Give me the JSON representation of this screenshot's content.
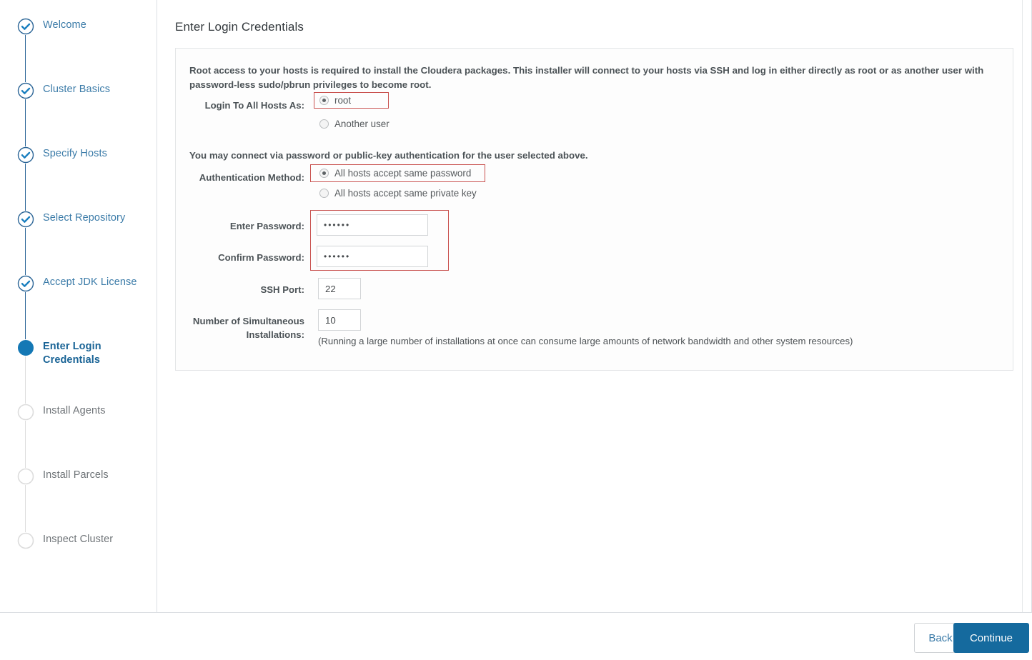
{
  "sidebar": {
    "steps": [
      {
        "label": "Welcome",
        "state": "done",
        "icon": "check-circle-icon"
      },
      {
        "label": "Cluster Basics",
        "state": "done",
        "icon": "check-circle-icon"
      },
      {
        "label": "Specify Hosts",
        "state": "done",
        "icon": "check-circle-icon"
      },
      {
        "label": "Select Repository",
        "state": "done",
        "icon": "check-circle-icon"
      },
      {
        "label": "Accept JDK License",
        "state": "done",
        "icon": "check-circle-icon"
      },
      {
        "label": "Enter Login Credentials",
        "state": "current",
        "icon": "filled-circle-icon"
      },
      {
        "label": "Install Agents",
        "state": "pending",
        "icon": "empty-circle-icon"
      },
      {
        "label": "Install Parcels",
        "state": "pending",
        "icon": "empty-circle-icon"
      },
      {
        "label": "Inspect Cluster",
        "state": "pending",
        "icon": "empty-circle-icon"
      }
    ]
  },
  "main": {
    "page_title": "Enter Login Credentials",
    "intro": "Root access to your hosts is required to install the Cloudera packages. This installer will connect to your hosts via SSH and log in either directly as root or as another user with password-less sudo/pbrun privileges to become root.",
    "login_as": {
      "label": "Login To All Hosts As:",
      "options": [
        {
          "label": "root",
          "selected": true
        },
        {
          "label": "Another user",
          "selected": false
        }
      ]
    },
    "auth_subhead": "You may connect via password or public-key authentication for the user selected above.",
    "auth_method": {
      "label": "Authentication Method:",
      "options": [
        {
          "label": "All hosts accept same password",
          "selected": true
        },
        {
          "label": "All hosts accept same private key",
          "selected": false
        }
      ]
    },
    "enter_password": {
      "label": "Enter Password:",
      "value": "••••••",
      "placeholder": ""
    },
    "confirm_password": {
      "label": "Confirm Password:",
      "value": "••••••",
      "placeholder": ""
    },
    "ssh_port": {
      "label": "SSH Port:",
      "value": "22",
      "placeholder": ""
    },
    "simultaneous": {
      "label_line1": "Number of Simultaneous",
      "label_line2": "Installations:",
      "value": "10",
      "placeholder": "",
      "hint": "(Running a large number of installations at once can consume large amounts of network bandwidth and other system resources)"
    }
  },
  "footer": {
    "back_label": "Back",
    "continue_label": "Continue"
  },
  "colors": {
    "accent": "#156a9e",
    "step_done": "#3b7ba8",
    "highlight": "#c9524f",
    "panel_border": "#e3e5e7"
  }
}
